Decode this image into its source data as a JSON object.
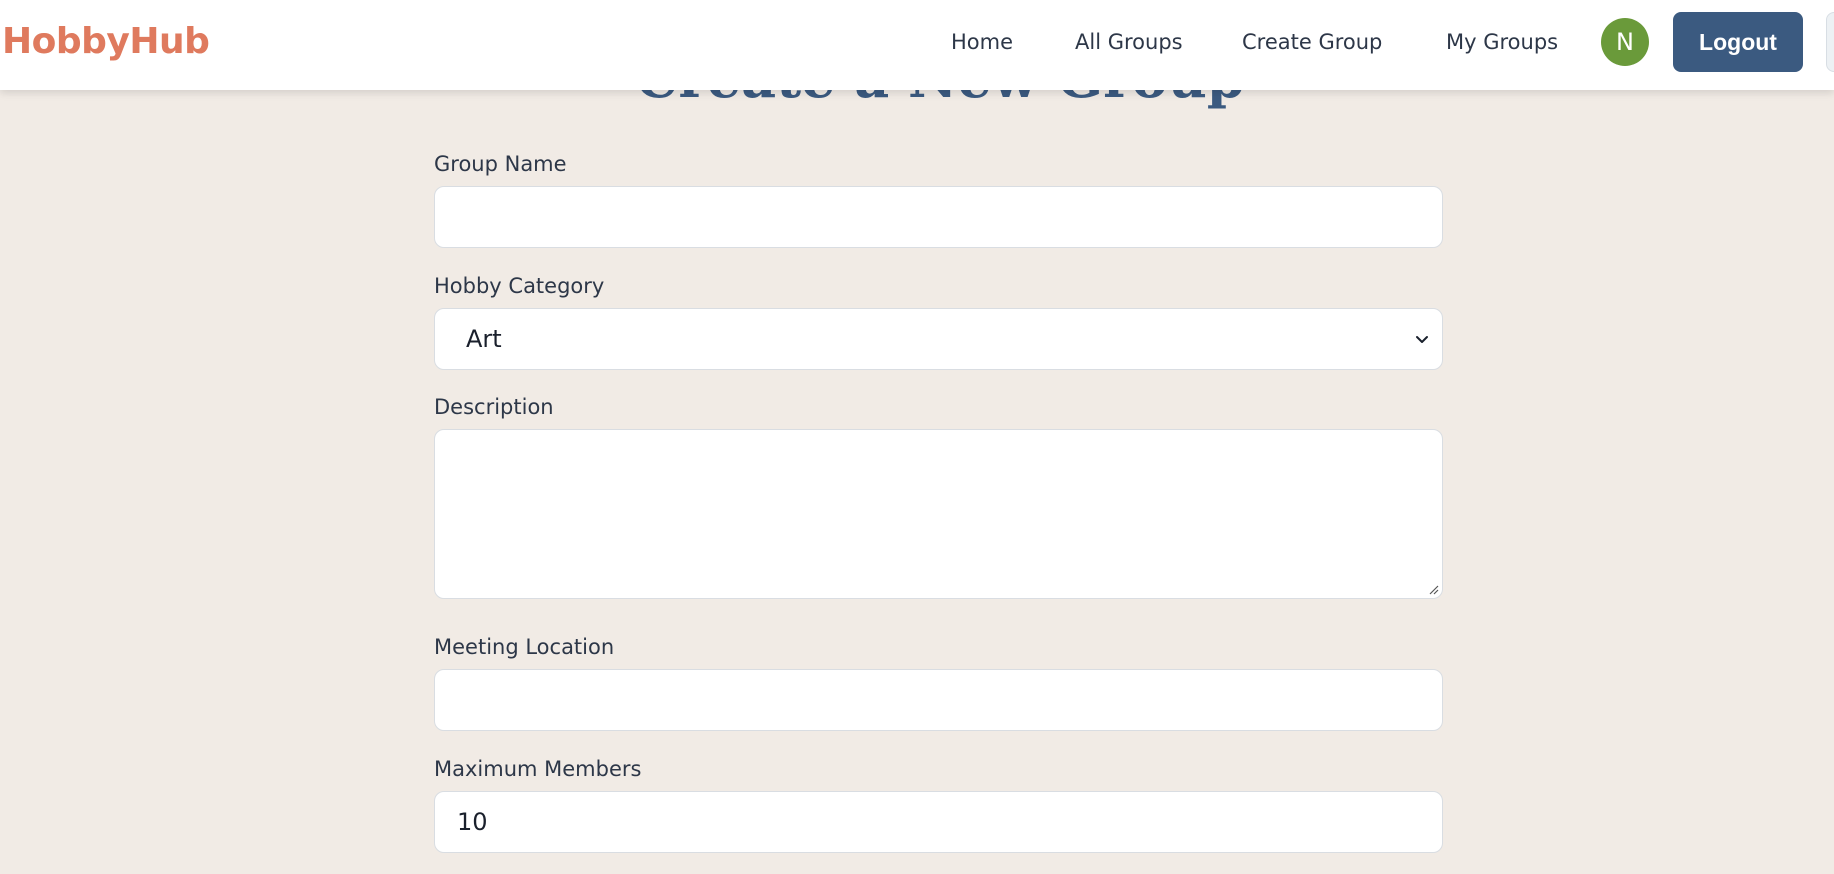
{
  "header": {
    "brand": "HobbyHub",
    "nav": [
      {
        "label": "Home"
      },
      {
        "label": "All Groups"
      },
      {
        "label": "Create Group"
      },
      {
        "label": "My Groups"
      }
    ],
    "avatar_initial": "N",
    "logout_label": "Logout"
  },
  "page": {
    "heading": "Create a New Group"
  },
  "form": {
    "group_name": {
      "label": "Group Name",
      "value": ""
    },
    "hobby_category": {
      "label": "Hobby Category",
      "selected": "Art"
    },
    "description": {
      "label": "Description",
      "value": ""
    },
    "meeting_location": {
      "label": "Meeting Location",
      "value": ""
    },
    "max_members": {
      "label": "Maximum Members",
      "value": "10"
    }
  },
  "colors": {
    "brand": "#df7a5e",
    "primary": "#3b5a80",
    "avatar": "#6a9a3a",
    "background": "#f1ebe5"
  }
}
